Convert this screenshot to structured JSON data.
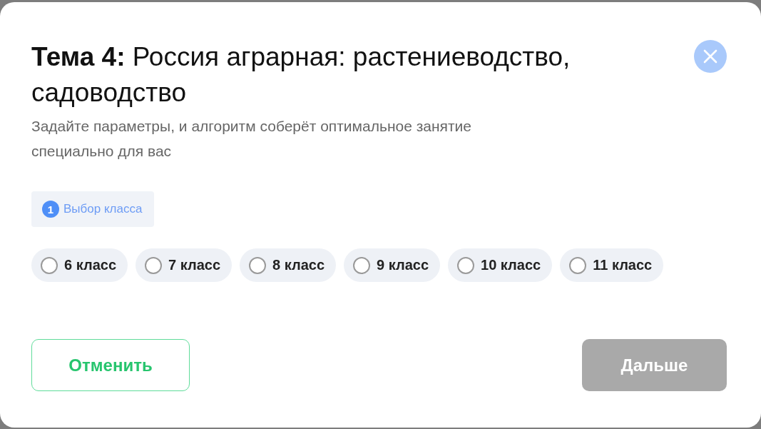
{
  "dialog": {
    "title": "**Тема 4:** Россия аграрная: растениеводство, садоводство",
    "subtitle": "Задайте параметры, и алгоритм соберёт оптимальное занятие специально для вас",
    "step": {
      "number": "1",
      "label": "Выбор класса"
    },
    "grades": [
      {
        "label": "6 класс",
        "selected": false
      },
      {
        "label": "7 класс",
        "selected": false
      },
      {
        "label": "8 класс",
        "selected": false
      },
      {
        "label": "9 класс",
        "selected": false
      },
      {
        "label": "10 класс",
        "selected": false
      },
      {
        "label": "11 класс",
        "selected": false
      }
    ],
    "buttons": [
      {
        "kind": "cancel",
        "label": "Отменить",
        "disabled": false
      },
      {
        "kind": "next",
        "label": "Дальше",
        "disabled": true
      }
    ]
  }
}
